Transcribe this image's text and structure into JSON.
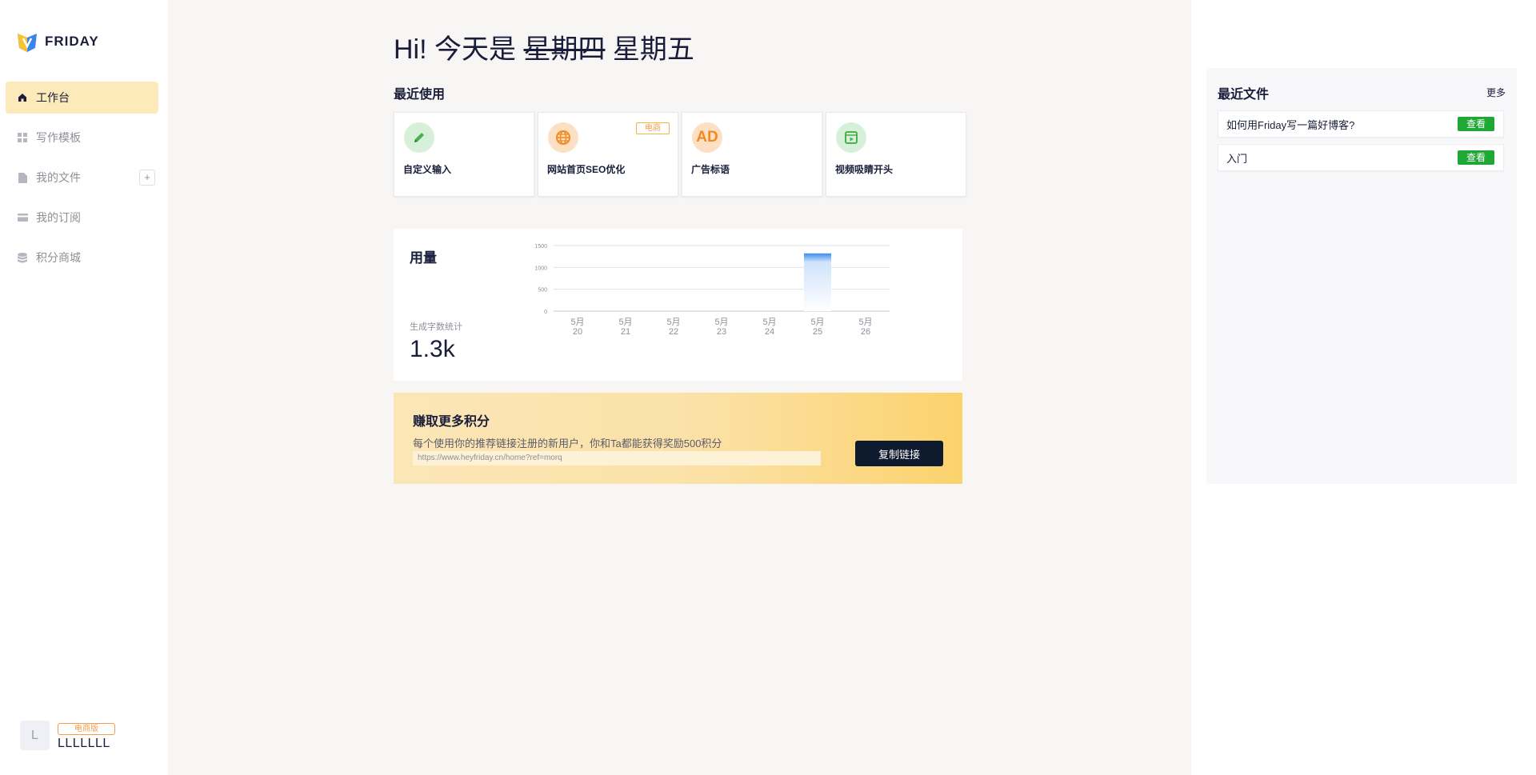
{
  "app": {
    "name": "FRIDAY"
  },
  "sidebar": {
    "items": [
      {
        "label": "工作台",
        "icon": "home-icon",
        "active": true
      },
      {
        "label": "写作模板",
        "icon": "grid-icon",
        "active": false
      },
      {
        "label": "我的文件",
        "icon": "file-icon",
        "active": false,
        "add_label": "+"
      },
      {
        "label": "我的订阅",
        "icon": "card-icon",
        "active": false
      },
      {
        "label": "积分商城",
        "icon": "coins-icon",
        "active": false
      }
    ]
  },
  "user": {
    "avatar_letter": "L",
    "plan": "电商版",
    "name": "LLLLLLL"
  },
  "greeting": {
    "prefix": "Hi! 今天是 ",
    "struck": "星期四",
    "today": " 星期五"
  },
  "recent": {
    "title": "最近使用",
    "cards": [
      {
        "label": "自定义输入",
        "icon": "pencil-icon",
        "tag": ""
      },
      {
        "label": "网站首页SEO优化",
        "icon": "globe-icon",
        "tag": "电商"
      },
      {
        "label": "广告标语",
        "icon": "ad-icon",
        "icon_text": "AD",
        "tag": ""
      },
      {
        "label": "视频吸睛开头",
        "icon": "video-icon",
        "tag": ""
      }
    ]
  },
  "usage": {
    "title": "用量",
    "subtitle": "生成字数统计",
    "value": "1.3k"
  },
  "chart_data": {
    "type": "bar",
    "categories": [
      "5月\n20",
      "5月\n21",
      "5月\n22",
      "5月\n23",
      "5月\n24",
      "5月\n25",
      "5月\n26"
    ],
    "values": [
      0,
      0,
      0,
      0,
      0,
      1320,
      0
    ],
    "ylim": [
      0,
      1500
    ],
    "yticks": [
      0,
      500,
      1000,
      1500
    ],
    "grid": true,
    "bar_color": "#3b8cf0"
  },
  "earn": {
    "title": "赚取更多积分",
    "description": "每个使用你的推荐链接注册的新用户，你和Ta都能获得奖励500积分",
    "link": "https://www.heyfriday.cn/home?ref=morq",
    "button": "复制链接"
  },
  "recent_files": {
    "title": "最近文件",
    "more": "更多",
    "files": [
      {
        "name": "如何用Friday写一篇好博客?",
        "action": "查看"
      },
      {
        "name": "入门",
        "action": "查看"
      }
    ]
  },
  "colors": {
    "accent_yellow": "#fdeabb",
    "green": "#1fa834",
    "navy": "#0e1a2e"
  }
}
